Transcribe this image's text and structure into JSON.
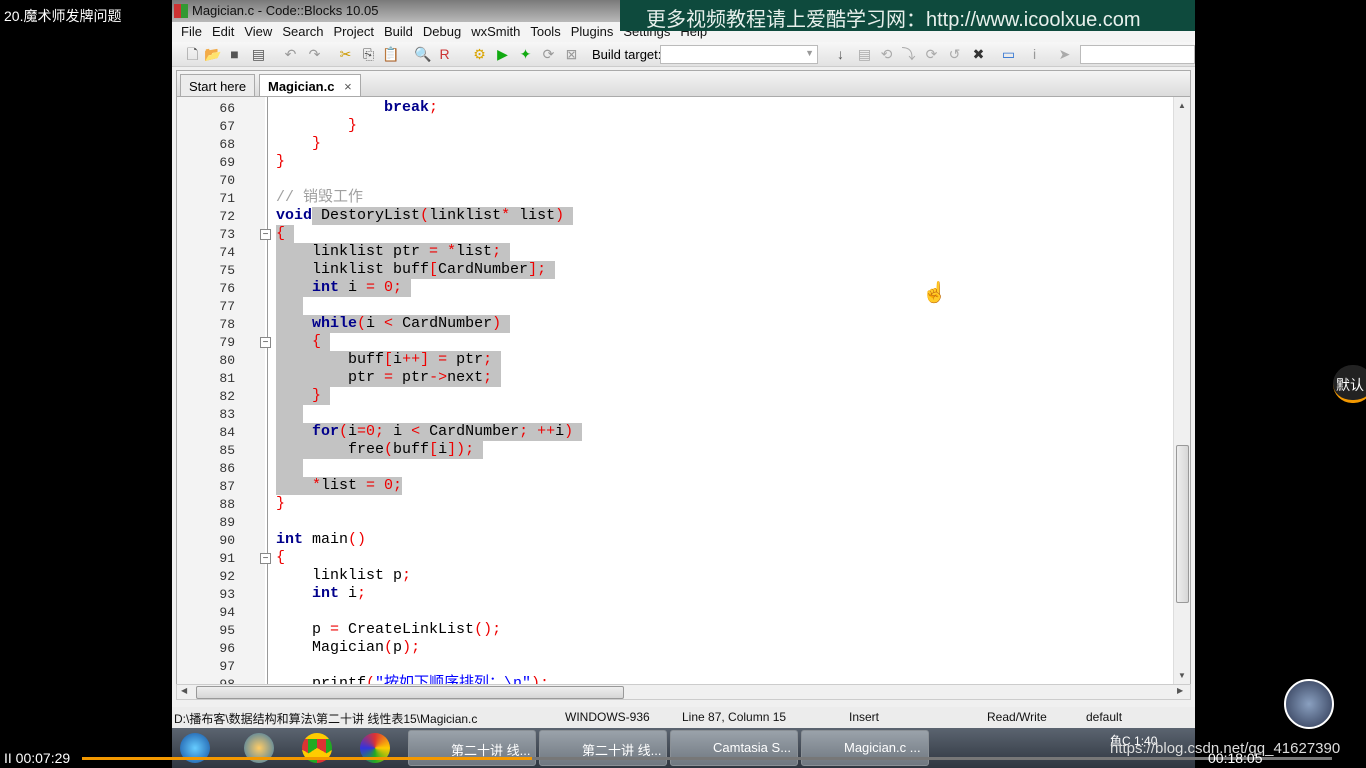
{
  "video": {
    "title": "20.魔术师发牌问题",
    "time_elapsed": "00:07:29",
    "time_total": "00:18:05",
    "progress": 0.36,
    "default_button": "默认",
    "pause_icon": "II",
    "watermark_url": "https://blog.csdn.net/qq_41627390"
  },
  "watermark": "更多视频教程请上爱酷学习网：http://www.icoolxue.com",
  "window": {
    "title": "Magician.c - Code::Blocks 10.05"
  },
  "menu": [
    "File",
    "Edit",
    "View",
    "Search",
    "Project",
    "Build",
    "Debug",
    "wxSmith",
    "Tools",
    "Plugins",
    "Settings",
    "Help"
  ],
  "toolbar": {
    "build_target_label": "Build target:",
    "build_target_value": ""
  },
  "tabs": [
    {
      "label": "Start here"
    },
    {
      "label": "Magician.c",
      "close": "×",
      "active": true
    }
  ],
  "code": [
    {
      "n": 66,
      "t": [
        [
          "kw",
          "            break"
        ],
        [
          "op",
          ";"
        ]
      ]
    },
    {
      "n": 67,
      "t": [
        [
          "op",
          "        }"
        ]
      ]
    },
    {
      "n": 68,
      "t": [
        [
          "op",
          "    }"
        ]
      ]
    },
    {
      "n": 69,
      "t": [
        [
          "op",
          "}"
        ]
      ]
    },
    {
      "n": 70,
      "t": []
    },
    {
      "n": 71,
      "t": [
        [
          "cm",
          "// 销毁工作"
        ]
      ]
    },
    {
      "n": 72,
      "t": [
        [
          "kw",
          "void"
        ],
        [
          "tx",
          " DestoryList"
        ],
        [
          "op",
          "("
        ],
        [
          "tx",
          "linklist"
        ],
        [
          "op",
          "*"
        ],
        [
          "tx",
          " list"
        ],
        [
          "op",
          ")"
        ]
      ]
    },
    {
      "n": 73,
      "t": [
        [
          "op",
          "{"
        ]
      ],
      "fold": true
    },
    {
      "n": 74,
      "t": [
        [
          "tx",
          "    linklist ptr "
        ],
        [
          "op",
          "= *"
        ],
        [
          "tx",
          "list"
        ],
        [
          "op",
          ";"
        ]
      ]
    },
    {
      "n": 75,
      "t": [
        [
          "tx",
          "    linklist buff"
        ],
        [
          "op",
          "["
        ],
        [
          "tx",
          "CardNumber"
        ],
        [
          "op",
          "];"
        ]
      ]
    },
    {
      "n": 76,
      "t": [
        [
          "kw",
          "    int"
        ],
        [
          "tx",
          " i "
        ],
        [
          "op",
          "= 0;"
        ]
      ]
    },
    {
      "n": 77,
      "t": []
    },
    {
      "n": 78,
      "t": [
        [
          "kw",
          "    while"
        ],
        [
          "op",
          "("
        ],
        [
          "tx",
          "i "
        ],
        [
          "op",
          "<"
        ],
        [
          "tx",
          " CardNumber"
        ],
        [
          "op",
          ")"
        ]
      ]
    },
    {
      "n": 79,
      "t": [
        [
          "op",
          "    {"
        ]
      ],
      "fold": true
    },
    {
      "n": 80,
      "t": [
        [
          "tx",
          "        buff"
        ],
        [
          "op",
          "["
        ],
        [
          "tx",
          "i"
        ],
        [
          "op",
          "++] ="
        ],
        [
          "tx",
          " ptr"
        ],
        [
          "op",
          ";"
        ]
      ]
    },
    {
      "n": 81,
      "t": [
        [
          "tx",
          "        ptr "
        ],
        [
          "op",
          "="
        ],
        [
          "tx",
          " ptr"
        ],
        [
          "op",
          "->"
        ],
        [
          "tx",
          "next"
        ],
        [
          "op",
          ";"
        ]
      ]
    },
    {
      "n": 82,
      "t": [
        [
          "op",
          "    }"
        ]
      ]
    },
    {
      "n": 83,
      "t": []
    },
    {
      "n": 84,
      "t": [
        [
          "kw",
          "    for"
        ],
        [
          "op",
          "("
        ],
        [
          "tx",
          "i"
        ],
        [
          "op",
          "=0;"
        ],
        [
          "tx",
          " i "
        ],
        [
          "op",
          "<"
        ],
        [
          "tx",
          " CardNumber"
        ],
        [
          "op",
          "; ++"
        ],
        [
          "tx",
          "i"
        ],
        [
          "op",
          ")"
        ]
      ]
    },
    {
      "n": 85,
      "t": [
        [
          "tx",
          "        free"
        ],
        [
          "op",
          "("
        ],
        [
          "tx",
          "buff"
        ],
        [
          "op",
          "["
        ],
        [
          "tx",
          "i"
        ],
        [
          "op",
          "]);"
        ]
      ]
    },
    {
      "n": 86,
      "t": []
    },
    {
      "n": 87,
      "t": [
        [
          "op",
          "    *"
        ],
        [
          "tx",
          "list "
        ],
        [
          "op",
          "= 0;"
        ]
      ]
    },
    {
      "n": 88,
      "t": [
        [
          "op",
          "}"
        ]
      ]
    },
    {
      "n": 89,
      "t": []
    },
    {
      "n": 90,
      "t": [
        [
          "kw",
          "int"
        ],
        [
          "tx",
          " main"
        ],
        [
          "op",
          "()"
        ]
      ]
    },
    {
      "n": 91,
      "t": [
        [
          "op",
          "{"
        ]
      ],
      "fold": true
    },
    {
      "n": 92,
      "t": [
        [
          "tx",
          "    linklist p"
        ],
        [
          "op",
          ";"
        ]
      ]
    },
    {
      "n": 93,
      "t": [
        [
          "kw",
          "    int"
        ],
        [
          "tx",
          " i"
        ],
        [
          "op",
          ";"
        ]
      ]
    },
    {
      "n": 94,
      "t": []
    },
    {
      "n": 95,
      "t": [
        [
          "tx",
          "    p "
        ],
        [
          "op",
          "="
        ],
        [
          "tx",
          " CreateLinkList"
        ],
        [
          "op",
          "();"
        ]
      ]
    },
    {
      "n": 96,
      "t": [
        [
          "tx",
          "    Magician"
        ],
        [
          "op",
          "("
        ],
        [
          "tx",
          "p"
        ],
        [
          "op",
          ");"
        ]
      ]
    },
    {
      "n": 97,
      "t": []
    },
    {
      "n": 98,
      "t": [
        [
          "tx",
          "    printf"
        ],
        [
          "op",
          "("
        ],
        [
          "st",
          "\"按如下顺序排列：\\n\""
        ],
        [
          "op",
          ");"
        ]
      ]
    }
  ],
  "status": {
    "path": "D:\\播布客\\数据结构和算法\\第二十讲 线性表15\\Magician.c",
    "encoding": "WINDOWS-936",
    "position": "Line 87, Column 15",
    "mode": "Insert",
    "access": "Read/Write",
    "lang": "default"
  },
  "taskbar": {
    "buttons": [
      "第二十讲 线...",
      "第二十讲 线...",
      "Camtasia S...",
      "Magician.c ..."
    ],
    "clock": "1:40",
    "lang": "鱼C"
  },
  "colors": {
    "keyword": "#00008b",
    "operator": "#ee0000",
    "comment": "#a0a0a0",
    "string": "#0000ff",
    "selection": "#c3c3c3",
    "watermark_bg": "#0e4a3d",
    "progress": "#f39800"
  }
}
